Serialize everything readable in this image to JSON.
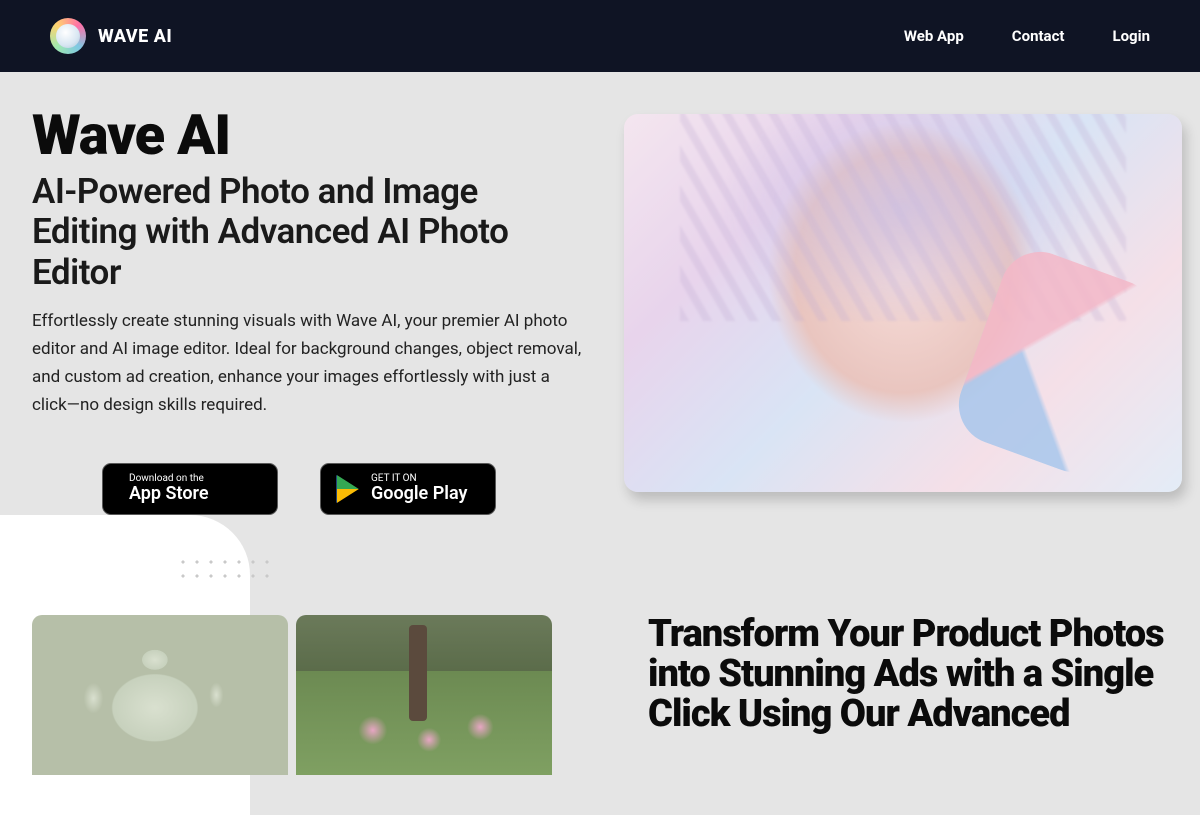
{
  "brand": {
    "name": "WAVE AI"
  },
  "nav": {
    "webapp": "Web App",
    "contact": "Contact",
    "login": "Login"
  },
  "hero": {
    "title": "Wave AI",
    "subtitle": "AI-Powered Photo and Image Editing with Advanced AI Photo Editor",
    "description": "Effortlessly create stunning visuals with Wave AI, your premier AI photo editor and AI image editor. Ideal for background changes, object removal, and custom ad creation, enhance your images effortlessly with just a click—no design skills required."
  },
  "store": {
    "apple_small": "Download on the",
    "apple_big": "App Store",
    "google_small": "GET IT ON",
    "google_big": "Google Play"
  },
  "section2": {
    "title": "Transform Your Product Photos into Stunning Ads with a Single Click Using Our Advanced"
  }
}
